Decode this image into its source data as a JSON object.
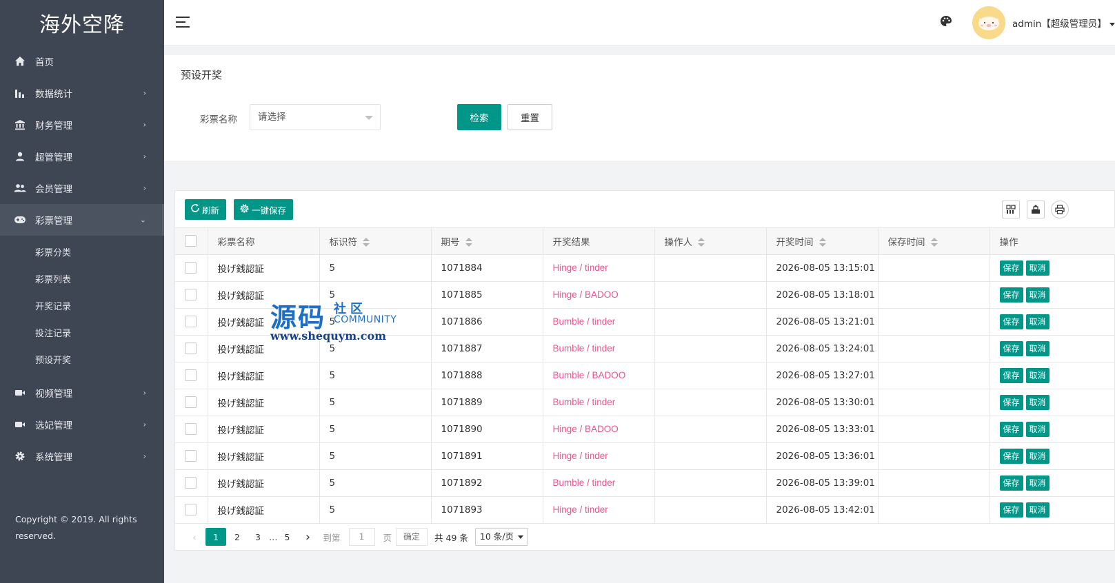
{
  "sidebar": {
    "logo": "海外空降",
    "items": [
      {
        "label": "首页",
        "icon": "home-icon",
        "has_children": false
      },
      {
        "label": "数据统计",
        "icon": "bar-chart-icon",
        "has_children": true
      },
      {
        "label": "财务管理",
        "icon": "bank-icon",
        "has_children": true
      },
      {
        "label": "超管管理",
        "icon": "user-icon",
        "has_children": true
      },
      {
        "label": "会员管理",
        "icon": "users-icon",
        "has_children": true
      },
      {
        "label": "彩票管理",
        "icon": "gamepad-icon",
        "has_children": true,
        "expanded": true
      },
      {
        "label": "视频管理",
        "icon": "video-icon",
        "has_children": true
      },
      {
        "label": "选妃管理",
        "icon": "video-icon",
        "has_children": true
      },
      {
        "label": "系统管理",
        "icon": "gear-icon",
        "has_children": true
      }
    ],
    "subitems": [
      "彩票分类",
      "彩票列表",
      "开奖记录",
      "投注记录",
      "预设开奖"
    ],
    "copyright": "Copyright © 2019. All rights reserved."
  },
  "header": {
    "username": "admin【超级管理员】"
  },
  "search": {
    "title": "预设开奖",
    "field_label": "彩票名称",
    "select_placeholder": "请选择",
    "search_label": "检索",
    "reset_label": "重置"
  },
  "toolbar": {
    "refresh_label": "刷新",
    "save_all_label": "一键保存"
  },
  "table": {
    "columns": [
      "彩票名称",
      "标识符",
      "期号",
      "开奖结果",
      "操作人",
      "开奖时间",
      "保存时间",
      "操作"
    ],
    "rows": [
      {
        "name": "投げ銭認証",
        "code": "5",
        "issue": "1071884",
        "result": "Hinge / tinder",
        "operator": "",
        "time": "2026-08-05 13:15:01",
        "saved": ""
      },
      {
        "name": "投げ銭認証",
        "code": "5",
        "issue": "1071885",
        "result": "Hinge / BADOO",
        "operator": "",
        "time": "2026-08-05 13:18:01",
        "saved": ""
      },
      {
        "name": "投げ銭認証",
        "code": "5",
        "issue": "1071886",
        "result": "Bumble / tinder",
        "operator": "",
        "time": "2026-08-05 13:21:01",
        "saved": ""
      },
      {
        "name": "投げ銭認証",
        "code": "5",
        "issue": "1071887",
        "result": "Bumble / tinder",
        "operator": "",
        "time": "2026-08-05 13:24:01",
        "saved": ""
      },
      {
        "name": "投げ銭認証",
        "code": "5",
        "issue": "1071888",
        "result": "Bumble / BADOO",
        "operator": "",
        "time": "2026-08-05 13:27:01",
        "saved": ""
      },
      {
        "name": "投げ銭認証",
        "code": "5",
        "issue": "1071889",
        "result": "Bumble / tinder",
        "operator": "",
        "time": "2026-08-05 13:30:01",
        "saved": ""
      },
      {
        "name": "投げ銭認証",
        "code": "5",
        "issue": "1071890",
        "result": "Hinge / BADOO",
        "operator": "",
        "time": "2026-08-05 13:33:01",
        "saved": ""
      },
      {
        "name": "投げ銭認証",
        "code": "5",
        "issue": "1071891",
        "result": "Hinge / tinder",
        "operator": "",
        "time": "2026-08-05 13:36:01",
        "saved": ""
      },
      {
        "name": "投げ銭認証",
        "code": "5",
        "issue": "1071892",
        "result": "Bumble / tinder",
        "operator": "",
        "time": "2026-08-05 13:39:01",
        "saved": ""
      },
      {
        "name": "投げ銭認証",
        "code": "5",
        "issue": "1071893",
        "result": "Hinge / tinder",
        "operator": "",
        "time": "2026-08-05 13:42:01",
        "saved": ""
      }
    ],
    "save_label": "保存",
    "cancel_label": "取消"
  },
  "pagination": {
    "prev": "‹",
    "pages": [
      "1",
      "2",
      "3"
    ],
    "ellipsis": "…",
    "last": "5",
    "next": "›",
    "goto_label": "到第",
    "goto_value": "1",
    "page_suffix": "页",
    "confirm_label": "确定",
    "total": "共 49 条",
    "page_size": "10 条/页",
    "current_page": 1
  },
  "watermark": {
    "main": "源码",
    "cn": "社区",
    "en": "COMMUNITY",
    "url": "www.shequym.com"
  },
  "colors": {
    "sidebar_bg": "#3e4553",
    "accent": "#009688",
    "result_text": "#f0518e"
  }
}
